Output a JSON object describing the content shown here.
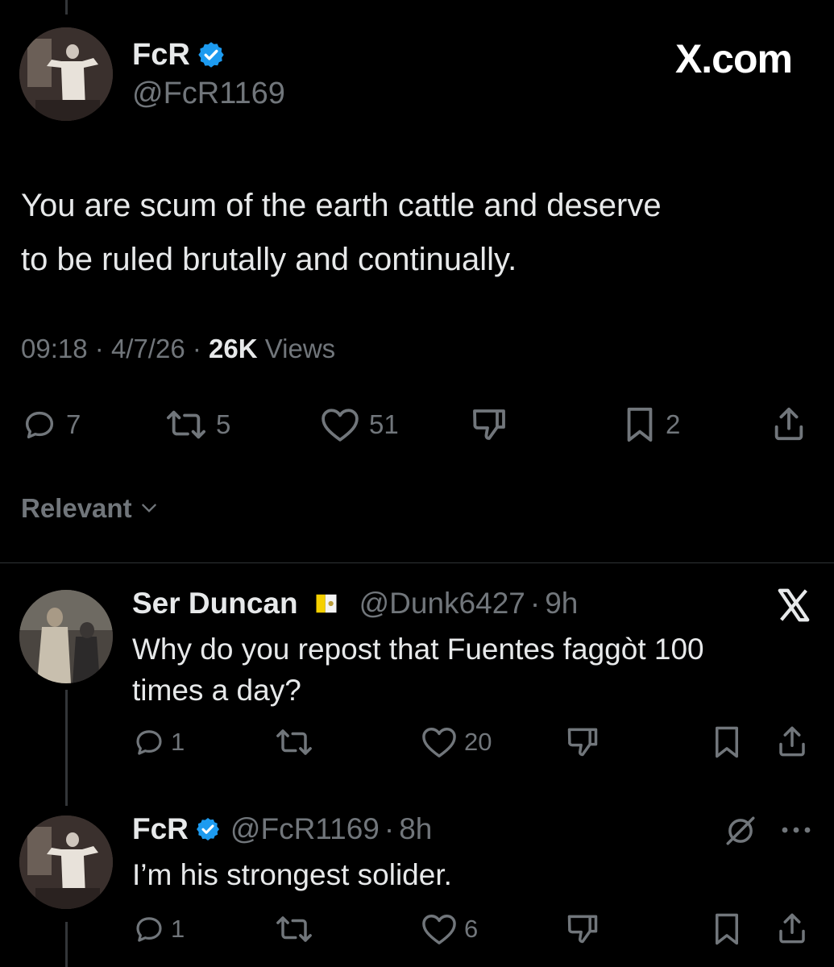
{
  "main_post": {
    "author_name": "FcR",
    "author_handle": "@FcR1169",
    "site_label": "X.com",
    "text_line1": "You are scum of the earth cattle and deserve",
    "text_line2": "to be ruled brutally and continually.",
    "time": "09:18",
    "date": "4/7/26",
    "views_count": "26K",
    "views_label": "Views",
    "replies": "7",
    "reposts": "5",
    "likes": "51",
    "bookmarks": "2",
    "sort_label": "Relevant"
  },
  "replies": [
    {
      "author_name": "Ser Duncan",
      "author_handle": "@Dunk6427",
      "age": "9h",
      "text_line1": "Why do you repost that Fuentes faggòt 100",
      "text_line2": "times a day?",
      "replies": "1",
      "likes": "20"
    },
    {
      "author_name": "FcR",
      "author_handle": "@FcR1169",
      "age": "8h",
      "text": "I’m his strongest solider.",
      "replies": "1",
      "likes": "6"
    }
  ],
  "colors": {
    "background": "#000000",
    "text": "#e7e9ea",
    "muted": "#71767b",
    "verified": "#1d9bf0"
  },
  "icons": [
    "reply-icon",
    "repost-icon",
    "like-icon",
    "dislike-icon",
    "bookmark-icon",
    "share-icon",
    "verified-icon",
    "x-logo-icon",
    "flag-icon",
    "mute-icon",
    "more-icon",
    "chevron-down-icon"
  ]
}
